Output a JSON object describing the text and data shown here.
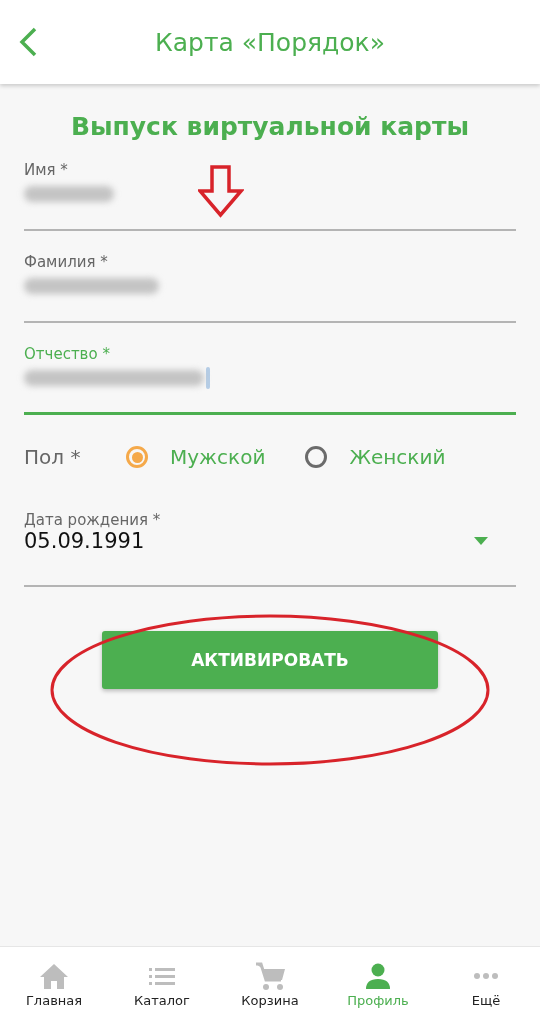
{
  "header": {
    "title": "Карта «Порядок»"
  },
  "heading": "Выпуск виртуальной карты",
  "fields": [
    {
      "label": "Имя *",
      "focused": false,
      "value_hidden": true
    },
    {
      "label": "Фамилия *",
      "focused": false,
      "value_hidden": true
    },
    {
      "label": "Отчество *",
      "focused": true,
      "value_hidden": true
    }
  ],
  "gender": {
    "label": "Пол *",
    "options": [
      {
        "label": "Мужской",
        "selected": true
      },
      {
        "label": "Женский",
        "selected": false
      }
    ]
  },
  "birth_date": {
    "label": "Дата рождения *",
    "value": "05.09.1991"
  },
  "submit_button": "АКТИВИРОВАТЬ",
  "annotations": {
    "arrow": true,
    "ellipse": true
  },
  "bottom_nav": [
    {
      "kind": "home",
      "label": "Главная",
      "selected": false
    },
    {
      "kind": "catalog",
      "label": "Каталог",
      "selected": false
    },
    {
      "kind": "cart",
      "label": "Корзина",
      "selected": false
    },
    {
      "kind": "profile",
      "label": "Профиль",
      "selected": true
    },
    {
      "kind": "more",
      "label": "Ещё",
      "selected": false
    }
  ]
}
